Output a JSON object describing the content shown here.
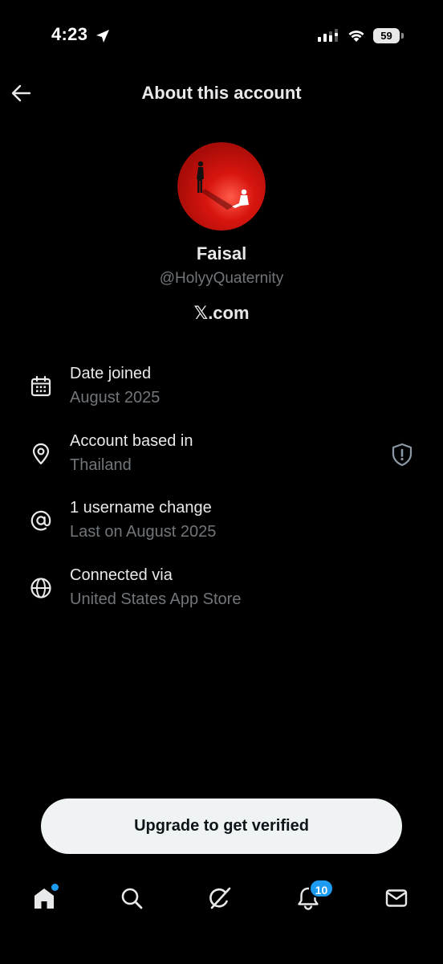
{
  "status_bar": {
    "time": "4:23",
    "battery": "59",
    "icons": [
      "location-arrow-icon",
      "signal-icon",
      "wifi-icon",
      "battery-icon"
    ]
  },
  "header": {
    "title": "About this account",
    "back_icon": "arrow-left-icon"
  },
  "profile": {
    "display_name": "Faisal",
    "handle": "@HolyyQuaternity",
    "site_prefix": "𝕏",
    "site_suffix": ".com",
    "avatar_colors": {
      "background": "#d4140f"
    }
  },
  "info": {
    "items": [
      {
        "icon": "calendar-icon",
        "title": "Date joined",
        "subtitle": "August 2025"
      },
      {
        "icon": "location-pin-icon",
        "title": "Account based in",
        "subtitle": "Thailand",
        "trailing_icon": "shield-icon"
      },
      {
        "icon": "at-sign-icon",
        "title": "1 username change",
        "subtitle": "Last on August 2025"
      },
      {
        "icon": "globe-icon",
        "title": "Connected via",
        "subtitle": "United States App Store"
      }
    ]
  },
  "upgrade": {
    "label": "Upgrade to get verified"
  },
  "tab_bar": {
    "tabs": [
      "home-icon",
      "search-icon",
      "grok-icon",
      "bell-icon",
      "mail-icon"
    ],
    "notifications_count": "10"
  },
  "colors": {
    "background": "#000000",
    "primary_text": "#e7e9ea",
    "secondary_text": "#71767b",
    "accent": "#1d9bf0",
    "button_bg": "#eff3f4"
  }
}
